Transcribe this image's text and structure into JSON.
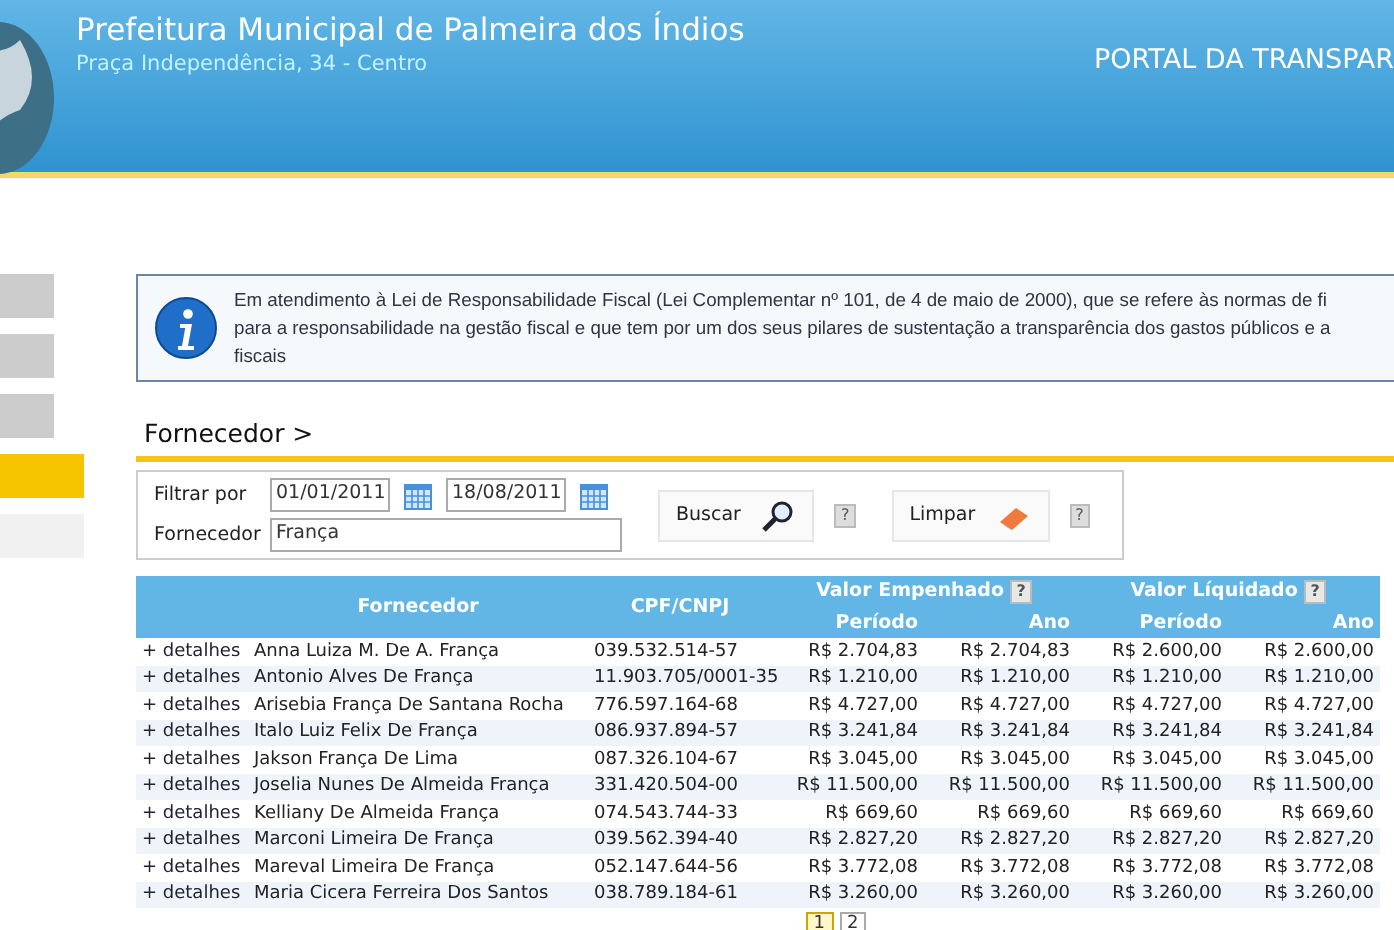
{
  "header": {
    "title": "Prefeitura Municipal de Palmeira dos Índios",
    "address": "Praça Independência, 34 - Centro",
    "portal": "PORTAL DA TRANSPAR"
  },
  "sidebar": {
    "items": [
      {
        "selected": false
      },
      {
        "selected": false
      },
      {
        "selected": false
      },
      {
        "selected": true
      },
      {
        "selected": false
      }
    ]
  },
  "info": {
    "lines": [
      "Em atendimento à Lei de Responsabilidade Fiscal (Lei Complementar nº 101, de 4 de maio de 2000), que se refere às normas de fi",
      "para a responsabilidade na gestão fiscal e que tem por um dos seus pilares de sustentação a transparência dos gastos públicos e a",
      "fiscais"
    ]
  },
  "section_title": "Fornecedor >",
  "filter": {
    "filter_label": "Filtrar por",
    "date_from": "01/01/2011",
    "date_to": "18/08/2011",
    "supplier_label": "Fornecedor",
    "supplier_value": "França",
    "buttons": [
      {
        "label": "Buscar",
        "kind": "search",
        "help": "?"
      },
      {
        "label": "Limpar",
        "kind": "clear",
        "help": "?"
      }
    ]
  },
  "table": {
    "columns": [
      "Fornecedor",
      "CPF/CNPJ"
    ],
    "groups": [
      {
        "label": "Valor Empenhado",
        "help": "?"
      },
      {
        "label": "Valor Líquidado",
        "help": "?"
      }
    ],
    "subcolumns": [
      "Período",
      "Ano",
      "Período",
      "Ano"
    ],
    "rows": [
      {
        "link": "+ detalhes",
        "name": "Anna Luiza M. De A. França",
        "doc": "039.532.514-57",
        "values": [
          "R$ 2.704,83",
          "R$ 2.704,83",
          "R$ 2.600,00",
          "R$ 2.600,00"
        ]
      },
      {
        "link": "+ detalhes",
        "name": "Antonio Alves De França",
        "doc": "11.903.705/0001-35",
        "values": [
          "R$ 1.210,00",
          "R$ 1.210,00",
          "R$ 1.210,00",
          "R$ 1.210,00"
        ]
      },
      {
        "link": "+ detalhes",
        "name": "Arisebia França De Santana Rocha",
        "doc": "776.597.164-68",
        "values": [
          "R$ 4.727,00",
          "R$ 4.727,00",
          "R$ 4.727,00",
          "R$ 4.727,00"
        ]
      },
      {
        "link": "+ detalhes",
        "name": "Italo Luiz Felix De França",
        "doc": "086.937.894-57",
        "values": [
          "R$ 3.241,84",
          "R$ 3.241,84",
          "R$ 3.241,84",
          "R$ 3.241,84"
        ]
      },
      {
        "link": "+ detalhes",
        "name": "Jakson França De Lima",
        "doc": "087.326.104-67",
        "values": [
          "R$ 3.045,00",
          "R$ 3.045,00",
          "R$ 3.045,00",
          "R$ 3.045,00"
        ]
      },
      {
        "link": "+ detalhes",
        "name": "Joselia Nunes De Almeida França",
        "doc": "331.420.504-00",
        "values": [
          "R$ 11.500,00",
          "R$ 11.500,00",
          "R$ 11.500,00",
          "R$ 11.500,00"
        ]
      },
      {
        "link": "+ detalhes",
        "name": "Kelliany De Almeida França",
        "doc": "074.543.744-33",
        "values": [
          "R$ 669,60",
          "R$ 669,60",
          "R$ 669,60",
          "R$ 669,60"
        ]
      },
      {
        "link": "+ detalhes",
        "name": "Marconi Limeira De França",
        "doc": "039.562.394-40",
        "values": [
          "R$ 2.827,20",
          "R$ 2.827,20",
          "R$ 2.827,20",
          "R$ 2.827,20"
        ]
      },
      {
        "link": "+ detalhes",
        "name": "Mareval Limeira De França",
        "doc": "052.147.644-56",
        "values": [
          "R$ 3.772,08",
          "R$ 3.772,08",
          "R$ 3.772,08",
          "R$ 3.772,08"
        ]
      },
      {
        "link": "+ detalhes",
        "name": "Maria Cicera Ferreira Dos Santos",
        "doc": "038.789.184-61",
        "values": [
          "R$ 3.260,00",
          "R$ 3.260,00",
          "R$ 3.260,00",
          "R$ 3.260,00"
        ]
      }
    ]
  },
  "pagination": {
    "pages": [
      {
        "label": "1",
        "selected": true
      },
      {
        "label": "2",
        "selected": false
      }
    ]
  }
}
